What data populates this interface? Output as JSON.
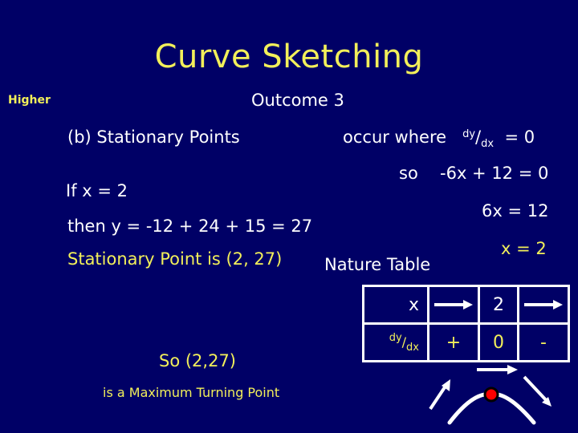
{
  "title": "Curve Sketching",
  "header": {
    "level": "Higher",
    "outcome": "Outcome 3"
  },
  "section": {
    "label": "(b)  Stationary Points",
    "condition_prefix": "occur  where",
    "derivative_num": "dy",
    "derivative_den": "dx",
    "condition_suffix": "=  0"
  },
  "working": {
    "step1_prefix": "so",
    "step1": "-6x + 12  =  0",
    "step2": "6x  =  12",
    "step3": "x  =  2"
  },
  "substitution": {
    "if_line": "If  x = 2",
    "then_line": "then  y = -12 + 24 + 15  =  27",
    "result": "Stationary Point is (2, 27)"
  },
  "nature_table": {
    "title": "Nature Table",
    "rows": [
      {
        "label": "x",
        "cells": [
          "arrow-right",
          "2",
          "arrow-right"
        ]
      },
      {
        "label_num": "dy",
        "label_den": "dx",
        "cells": [
          "+",
          "0",
          "-"
        ]
      }
    ],
    "slope_icons": [
      "arrow-up-right-icon",
      "arrow-right-icon",
      "arrow-down-right-icon"
    ],
    "turning_point_marker_color": "#ff0000"
  },
  "conclusion": {
    "line1": "So  (2,27)",
    "line2": "is a Maximum  Turning Point"
  },
  "colors": {
    "background": "#000066",
    "accent_yellow": "#f2ef5a",
    "text_white": "#ffffff",
    "marker_red": "#ff0000"
  }
}
